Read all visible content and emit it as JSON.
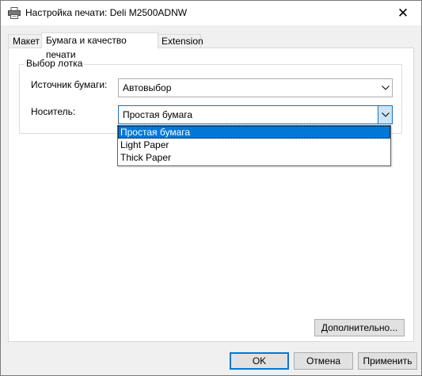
{
  "window": {
    "title": "Настройка печати: Deli M2500ADNW",
    "close_glyph": "✕"
  },
  "tabs": [
    {
      "label": "Макет"
    },
    {
      "label": "Бумага и качество печати"
    },
    {
      "label": "Extension"
    }
  ],
  "tray_group": {
    "label": "Выбор лотка",
    "paper_source": {
      "label": "Источник бумаги:",
      "value": "Автовыбор"
    },
    "media": {
      "label": "Носитель:",
      "value": "Простая бумага",
      "options": [
        "Простая бумага",
        "Light Paper",
        "Thick Paper"
      ]
    }
  },
  "advanced_button": "Дополнительно...",
  "footer": {
    "ok": "OK",
    "cancel": "Отмена",
    "apply": "Применить"
  },
  "colors": {
    "accent": "#0078d7",
    "selection": "#0078d7",
    "chevron_highlight": "#cce4f7"
  }
}
